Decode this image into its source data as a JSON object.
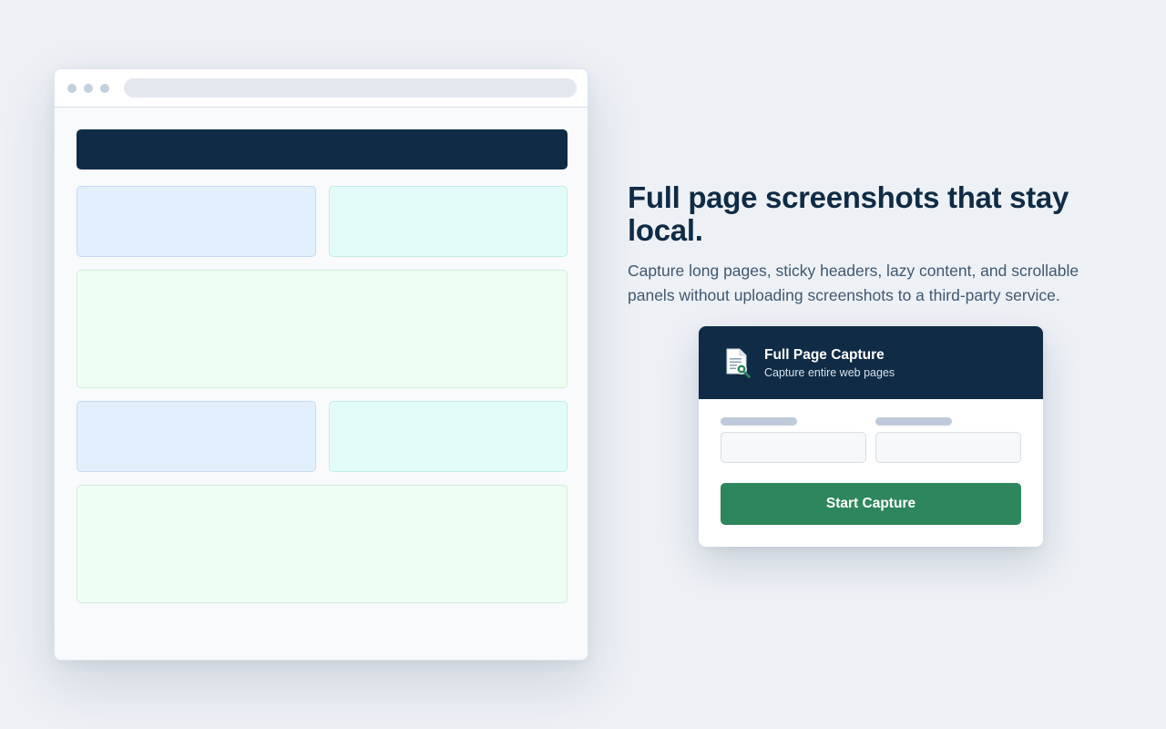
{
  "hero": {
    "headline": "Full page screenshots that stay local.",
    "subtext": "Capture long pages, sticky headers, lazy content, and scrollable panels without uploading screenshots to a third-party service."
  },
  "popup": {
    "title": "Full Page Capture",
    "subtitle": "Capture entire web pages",
    "icon": "document-magnifier-icon",
    "start_button": "Start Capture"
  },
  "colors": {
    "background": "#edf1f6",
    "navy": "#0f2b46",
    "accent_green": "#2e865c",
    "block_blue": "#e2effc",
    "block_cyan": "#e2fdf9",
    "block_green": "#effef3"
  }
}
